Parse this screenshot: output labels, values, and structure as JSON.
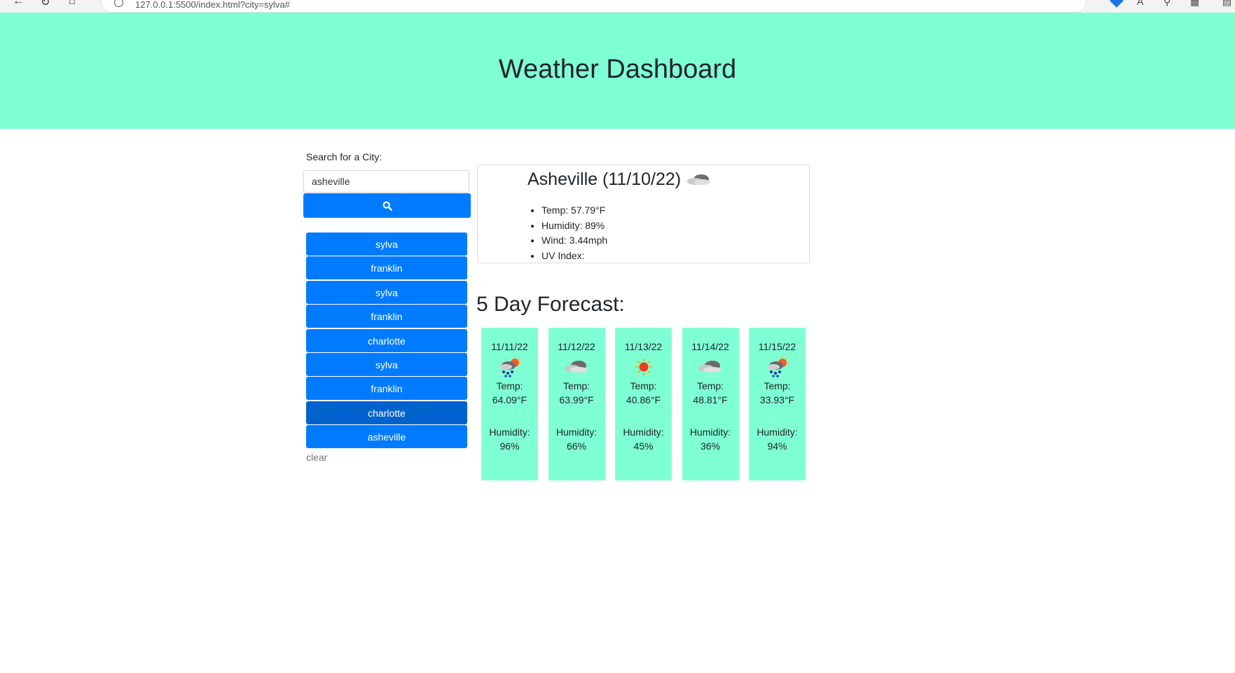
{
  "browser": {
    "url": "127.0.0.1:5500/index.html?city=sylva#"
  },
  "header": {
    "title": "Weather Dashboard"
  },
  "search": {
    "label": "Search for a City:",
    "value": "asheville",
    "button_icon": "search-icon"
  },
  "history": {
    "items": [
      {
        "label": "sylva"
      },
      {
        "label": "franklin"
      },
      {
        "label": "sylva"
      },
      {
        "label": "franklin"
      },
      {
        "label": "charlotte"
      },
      {
        "label": "sylva"
      },
      {
        "label": "franklin"
      },
      {
        "label": "charlotte"
      },
      {
        "label": "asheville"
      }
    ],
    "clear_label": "clear"
  },
  "current": {
    "title": "Asheville (11/10/22)",
    "icon": "cloudy-icon",
    "details": [
      "Temp: 57.79°F",
      "Humidity: 89%",
      "Wind: 3.44mph",
      "UV Index:"
    ]
  },
  "forecast": {
    "heading": "5 Day Forecast:",
    "days": [
      {
        "date": "11/11/22",
        "icon": "rain-sun-icon",
        "temp_label": "Temp:",
        "temp": "64.09°F",
        "humidity_label": "Humidity:",
        "humidity": "96%"
      },
      {
        "date": "11/12/22",
        "icon": "cloud-icon",
        "temp_label": "Temp:",
        "temp": "63.99°F",
        "humidity_label": "Humidity:",
        "humidity": "66%"
      },
      {
        "date": "11/13/22",
        "icon": "sun-icon",
        "temp_label": "Temp:",
        "temp": "40.86°F",
        "humidity_label": "Humidity:",
        "humidity": "45%"
      },
      {
        "date": "11/14/22",
        "icon": "cloud-icon",
        "temp_label": "Temp:",
        "temp": "48.81°F",
        "humidity_label": "Humidity:",
        "humidity": "36%"
      },
      {
        "date": "11/15/22",
        "icon": "rain-sun-icon",
        "temp_label": "Temp:",
        "temp": "33.93°F",
        "humidity_label": "Humidity:",
        "humidity": "94%"
      }
    ]
  },
  "colors": {
    "header_bg": "#7fffd4",
    "primary": "#007bff",
    "primary_active": "#0062cc",
    "forecast_card_bg": "#7fffd4"
  }
}
